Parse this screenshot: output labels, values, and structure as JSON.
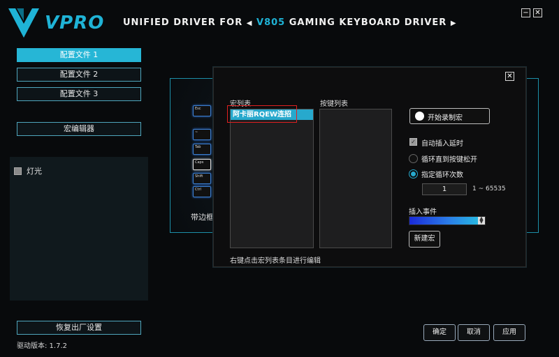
{
  "header": {
    "brand": "VPRO",
    "tagline_prefix": "UNIFIED DRIVER FOR",
    "arrow_left": "◀",
    "model": "V805",
    "tagline_suffix": "GAMING KEYBOARD DRIVER",
    "arrow_right": "▶",
    "minimize_icon": "minimize-icon",
    "close_icon": "close-icon"
  },
  "sidebar": {
    "profiles": [
      "配置文件 1",
      "配置文件 2",
      "配置文件 3"
    ],
    "active_profile": 0,
    "macro_editor": "宏编辑器",
    "light_label": "灯光",
    "reset": "恢复出厂设置",
    "version": "驱动版本:  1.7.2"
  },
  "keyboard_preview": {
    "keys": [
      "Esc",
      "~",
      "Tab",
      "Caps",
      "Shift",
      "Ctrl"
    ],
    "caption": "带边框"
  },
  "macro_dialog": {
    "macro_list_label": "宏列表",
    "key_list_label": "按键列表",
    "macro_items": [
      "阿卡丽RQEW连招"
    ],
    "edit_hint": "右键点击宏列表条目进行编辑",
    "record_button": "开始录制宏",
    "auto_insert_delay": "自动插入延时",
    "auto_insert_delay_checked": true,
    "loop_until_release": "循环直到按键松开",
    "loop_count_mode": "指定循环次数",
    "selected_loop_mode": "loop_count",
    "loop_count_value": "1",
    "loop_range": "1 ~ 65535",
    "insert_event_label": "插入事件",
    "new_macro": "新建宏",
    "close_glyph": "✕"
  },
  "footer": {
    "confirm": "确定",
    "cancel": "取消",
    "apply": "应用"
  },
  "colors": {
    "accent": "#27a9cd",
    "background": "#080a0c",
    "highlight_box": "#e02020"
  }
}
